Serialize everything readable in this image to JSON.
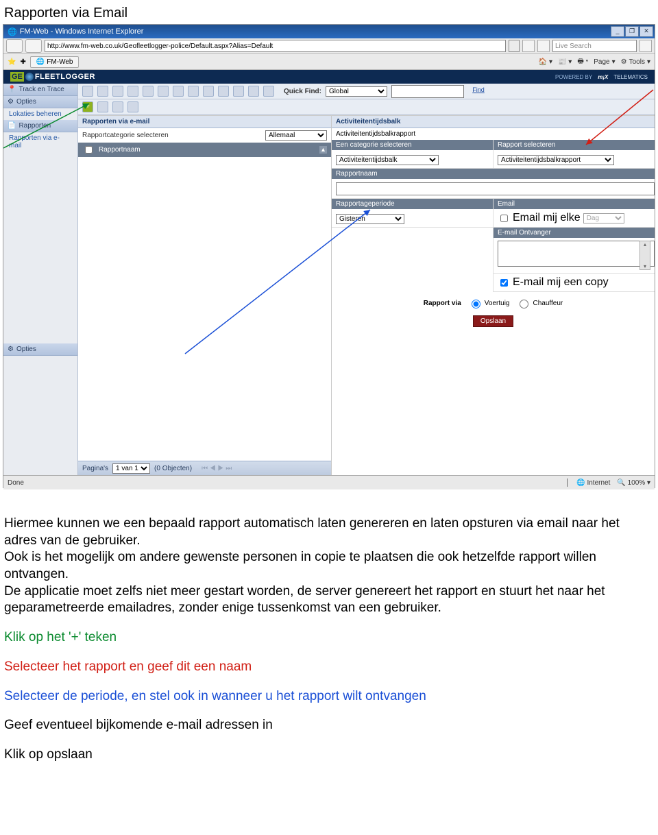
{
  "doc": {
    "title": "Rapporten via Email",
    "p1": "Hiermee kunnen we een bepaald rapport automatisch laten genereren en laten opsturen via email naar het adres van de gebruiker.",
    "p2": "Ook is het mogelijk om andere gewenste personen in copie te plaatsen die ook hetzelfde rapport willen ontvangen.",
    "p3": "De applicatie moet zelfs niet meer gestart worden, de server genereert het rapport en stuurt het naar het geparametreerde emailadres, zonder enige tussenkomst van een gebruiker.",
    "step_green": "Klik op het '+' teken",
    "step_red": "Selecteer het rapport en geef dit een naam",
    "step_blue": "Selecteer de periode, en stel ook in wanneer u het rapport wilt ontvangen",
    "step4": "Geef eventueel bijkomende e-mail adressen in",
    "step5": "Klik op opslaan"
  },
  "ie": {
    "title": "FM-Web - Windows Internet Explorer",
    "url": "http://www.fm-web.co.uk/Geofleetlogger-police/Default.aspx?Alias=Default",
    "search_placeholder": "Live Search",
    "fav_tab": "FM-Web",
    "tool_page": "Page",
    "tool_tools": "Tools",
    "status_done": "Done",
    "status_zone": "Internet",
    "status_zoom": "100%"
  },
  "app": {
    "logo_geo": "GE",
    "logo_fl": "FLEETLOGGER",
    "powered": "POWERED BY",
    "mx": "m¡X",
    "tel": "TELEMATICS",
    "side_track": "Track en Trace",
    "side_opties": "Opties",
    "side_lokaties": "Lokaties beheren",
    "side_rapporten": "Rapporten",
    "side_rve": "Rapporten via e-mail",
    "side_opties2": "Opties",
    "quickfind": "Quick Find:",
    "qf_select": "Global",
    "qf_find": "Find",
    "left": {
      "title": "Rapporten via e-mail",
      "cat_label": "Rapportcategorie selecteren",
      "cat_value": "Allemaal",
      "colhdr": "Rapportnaam"
    },
    "right": {
      "title": "Activiteitentijdsbalk",
      "sub": "Activiteitentijdsbalkrapport",
      "cat_hdr": "Een categorie selecteren",
      "cat_val": "Activiteitentijdsbalk",
      "rep_hdr": "Rapport selecteren",
      "rep_val": "Activiteitentijdsbalkrapport",
      "name_hdr": "Rapportnaam",
      "period_hdr": "Rapportageperiode",
      "period_val": "Gisteren",
      "email_hdr": "Email",
      "email_chk": "Email mij elke",
      "email_freq": "Dag",
      "recip_hdr": "E-mail Ontvanger",
      "cc_chk": "E-mail mij een copy",
      "via_label": "Rapport via",
      "via_v": "Voertuig",
      "via_c": "Chauffeur",
      "save": "Opslaan"
    },
    "pager": {
      "label": "Pagina's",
      "val": "1 van 1",
      "objects": "(0 Objecten)"
    }
  }
}
